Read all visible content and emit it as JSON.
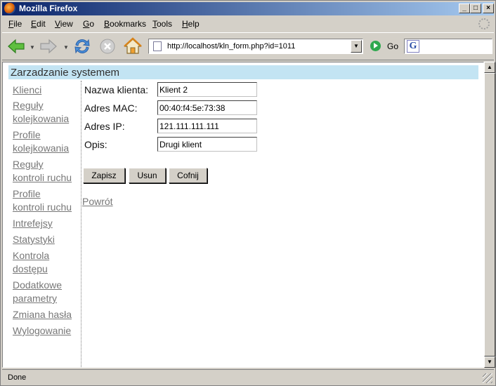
{
  "window": {
    "title": "Mozilla Firefox"
  },
  "title_buttons": {
    "minimize": "_",
    "maximize": "□",
    "close": "×"
  },
  "menu": {
    "items": [
      {
        "label": "File",
        "key": "F",
        "rest": "ile"
      },
      {
        "label": "Edit",
        "key": "E",
        "rest": "dit"
      },
      {
        "label": "View",
        "key": "V",
        "rest": "iew"
      },
      {
        "label": "Go",
        "key": "G",
        "rest": "o"
      },
      {
        "label": "Bookmarks",
        "key": "B",
        "rest": "ookmarks"
      },
      {
        "label": "Tools",
        "key": "T",
        "rest": "ools"
      },
      {
        "label": "Help",
        "key": "H",
        "rest": "elp"
      }
    ]
  },
  "toolbar": {
    "url": "http://localhost/kln_form.php?id=1011",
    "go_label": "Go",
    "search_value": ""
  },
  "page": {
    "header": "Zarzadzanie systemem",
    "sidebar": [
      {
        "lines": [
          "Klienci"
        ]
      },
      {
        "lines": [
          "Reguły",
          "kolejkowania"
        ]
      },
      {
        "lines": [
          "Profile",
          "kolejkowania"
        ]
      },
      {
        "lines": [
          "Reguły",
          "kontroli ruchu"
        ]
      },
      {
        "lines": [
          "Profile",
          "kontroli ruchu"
        ]
      },
      {
        "lines": [
          "Intrefejsy"
        ]
      },
      {
        "lines": [
          "Statystyki"
        ]
      },
      {
        "lines": [
          "Kontrola",
          "dostępu"
        ]
      },
      {
        "lines": [
          "Dodatkowe",
          "parametry"
        ]
      },
      {
        "lines": [
          "Zmiana hasła"
        ]
      },
      {
        "lines": [
          "Wylogowanie"
        ]
      }
    ],
    "form": {
      "name_label": "Nazwa klienta:",
      "name_value": "Klient 2",
      "mac_label": "Adres MAC:",
      "mac_value": "00:40:f4:5e:73:38",
      "ip_label": "Adres IP:",
      "ip_value": "121.111.111.111",
      "desc_label": "Opis:",
      "desc_value": "Drugi klient",
      "save_label": "Zapisz",
      "delete_label": "Usun",
      "undo_label": "Cofnij"
    },
    "back_link": "Powrót"
  },
  "status": {
    "text": "Done"
  },
  "colors": {
    "header_bg": "#c3e4f3",
    "link": "#777777",
    "titlebar": "#0a246a"
  },
  "icons": [
    "firefox-icon",
    "back-arrow-icon",
    "forward-arrow-icon",
    "reload-icon",
    "stop-icon",
    "home-icon",
    "page-icon",
    "go-icon",
    "google-icon",
    "throbber-icon"
  ]
}
